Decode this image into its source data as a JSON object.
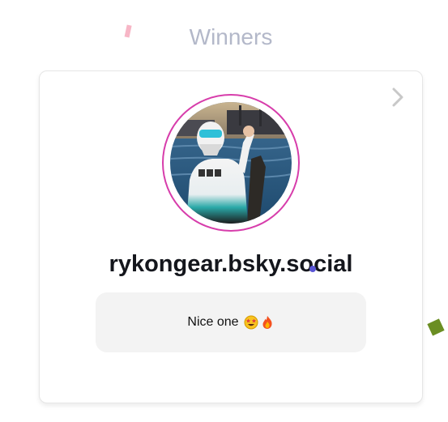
{
  "section": {
    "title": "Winners"
  },
  "winner": {
    "handle": "rykongear.bsky.social",
    "message": "Nice one",
    "emojis": [
      "star-struck-emoji",
      "fire-emoji"
    ]
  },
  "colors": {
    "title": "#b3b8c9",
    "avatar_ring": "#d73dab",
    "handle": "#14161c",
    "message_bg": "#f3f3f3",
    "chevron": "#c8c8c8"
  },
  "icons": {
    "next": "chevron-right-icon"
  }
}
